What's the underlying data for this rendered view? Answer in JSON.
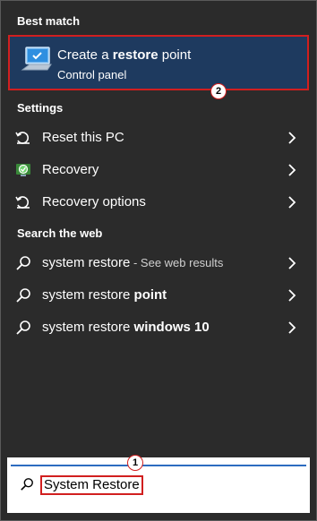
{
  "best_match": {
    "heading": "Best match",
    "title_pre": "Create a ",
    "title_bold": "restore",
    "title_post": " point",
    "subtitle": "Control panel",
    "badge": "2"
  },
  "settings": {
    "heading": "Settings",
    "items": [
      {
        "label": "Reset this PC",
        "icon": "reset-pc-icon"
      },
      {
        "label": "Recovery",
        "icon": "recovery-icon"
      },
      {
        "label": "Recovery options",
        "icon": "recovery-options-icon"
      }
    ]
  },
  "web": {
    "heading": "Search the web",
    "items": [
      {
        "query": "system restore",
        "suffix": " - See web results",
        "bold": ""
      },
      {
        "query": "system restore ",
        "suffix": "",
        "bold": "point"
      },
      {
        "query": "system restore ",
        "suffix": "",
        "bold": "windows 10"
      }
    ]
  },
  "search": {
    "value": "System Restore",
    "badge": "1"
  },
  "colors": {
    "panel_bg": "#2b2b2b",
    "selected_bg": "#1e3a5f",
    "highlight": "#d11f1f",
    "accent": "#2d6cc0"
  }
}
